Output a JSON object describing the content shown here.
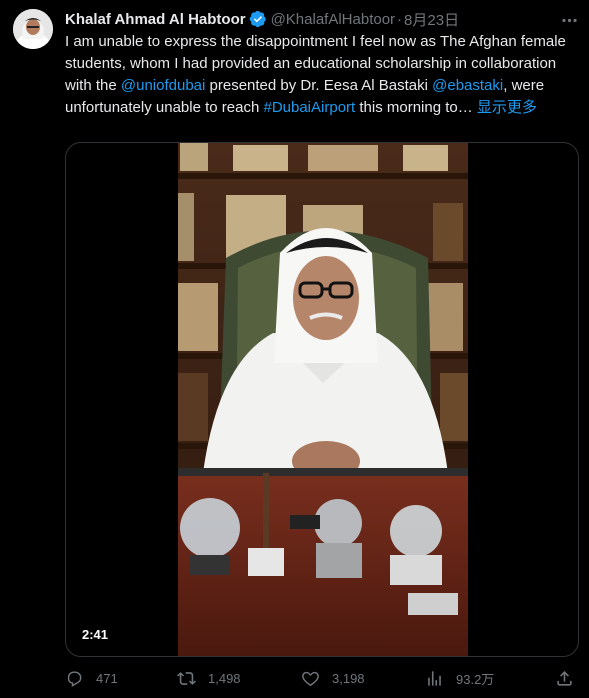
{
  "author": {
    "name": "Khalaf Ahmad Al Habtoor",
    "handle": "@KhalafAlHabtoor",
    "separator": "·",
    "date": "8月23日"
  },
  "tweet": {
    "text_1": "I am unable to express the disappointment I feel now as  The Afghan female students, whom I had provided an educational scholarship in collaboration with the ",
    "mention_1": "@uniofdubai",
    "text_2": " presented by Dr. Eesa Al Bastaki ",
    "mention_2": "@ebastaki",
    "text_3": ", were unfortunately unable to reach ",
    "hashtag_1": "#DubaiAirport",
    "text_4": " this morning to…",
    "show_more": " 显示更多"
  },
  "media": {
    "duration": "2:41"
  },
  "actions": {
    "replies": "471",
    "retweets": "1,498",
    "likes": "3,198",
    "views": "93.2万"
  },
  "icons": {
    "verified": "verified-badge-icon",
    "more": "more-icon",
    "reply": "reply-icon",
    "retweet": "retweet-icon",
    "like": "like-icon",
    "views": "views-icon",
    "share": "share-icon"
  },
  "colors": {
    "background": "#000000",
    "text": "#e7e9ea",
    "muted": "#71767b",
    "link": "#1d9bf0",
    "border": "#2f3336"
  }
}
